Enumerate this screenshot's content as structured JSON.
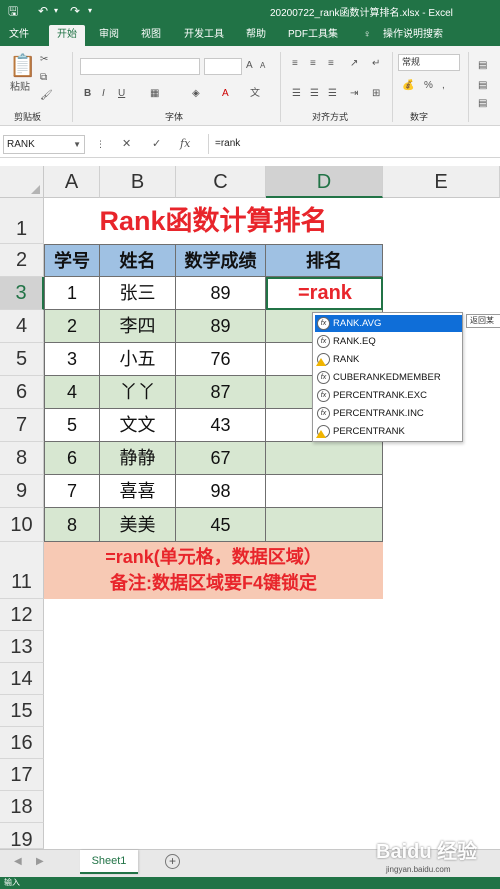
{
  "titlebar": {
    "file_title": "20200722_rank函数计算排名.xlsx  -  Excel",
    "save_icon": "save-icon",
    "undo_icon": "undo-icon",
    "redo_icon": "redo-icon"
  },
  "tabs": [
    "文件",
    "开始",
    "审阅",
    "视图",
    "开发工具",
    "帮助",
    "PDF工具集",
    "操作说明搜索"
  ],
  "active_tab": "开始",
  "ribbon": {
    "paste_label": "粘贴",
    "clipboard_label": "剪贴板",
    "font_label": "字体",
    "align_label": "对齐方式",
    "number_label": "数字",
    "number_format": "常规"
  },
  "formula_bar": {
    "name_box": "RANK",
    "cancel": "✕",
    "enter": "✓",
    "fx": "fx",
    "formula": "=rank"
  },
  "columns": [
    "A",
    "B",
    "C",
    "D",
    "E"
  ],
  "rows": [
    "1",
    "2",
    "3",
    "4",
    "5",
    "6",
    "7",
    "8",
    "9",
    "10",
    "11",
    "12",
    "13",
    "14",
    "15",
    "16",
    "17",
    "18",
    "19"
  ],
  "sheet": {
    "title": "Rank函数计算排名",
    "headers": [
      "学号",
      "姓名",
      "数学成绩",
      "排名"
    ],
    "records": [
      {
        "id": "1",
        "name": "张三",
        "score": "89"
      },
      {
        "id": "2",
        "name": "李四",
        "score": "89"
      },
      {
        "id": "3",
        "name": "小五",
        "score": "76"
      },
      {
        "id": "4",
        "name": "丫丫",
        "score": "87"
      },
      {
        "id": "5",
        "name": "文文",
        "score": "43"
      },
      {
        "id": "6",
        "name": "静静",
        "score": "67"
      },
      {
        "id": "7",
        "name": "喜喜",
        "score": "98"
      },
      {
        "id": "8",
        "name": "美美",
        "score": "45"
      }
    ],
    "active_cell_value": "=rank",
    "note_line1": "=rank(单元格，数据区域）",
    "note_line2": "备注:数据区域要F4键锁定"
  },
  "autocomplete": {
    "items": [
      "RANK.AVG",
      "RANK.EQ",
      "RANK",
      "CUBERANKEDMEMBER",
      "PERCENTRANK.EXC",
      "PERCENTRANK.INC",
      "PERCENTRANK"
    ],
    "selected": "RANK.AVG",
    "tooltip": "返回某"
  },
  "sheet_tabs": {
    "active": "Sheet1",
    "add_icon": "plus-icon"
  },
  "status": {
    "text": "输入"
  },
  "watermark": {
    "brand": "Baidu 经验",
    "url": "jingyan.baidu.com"
  },
  "colors": {
    "excel_green": "#217346",
    "title_red": "#e8252b",
    "header_blue": "#9fc1e3",
    "row_green": "#d7e7d1",
    "note_peach": "#f7c9b4"
  }
}
